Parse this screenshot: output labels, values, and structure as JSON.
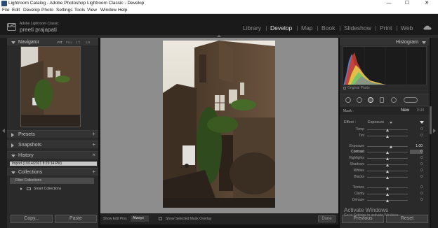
{
  "window": {
    "title": "Lightroom Catalog - Adobe Photoshop Lightroom Classic - Develop",
    "minimize": "—",
    "maximize": "☐",
    "close": "✕"
  },
  "menu": [
    "File",
    "Edit",
    "Develop",
    "Photo",
    "Settings",
    "Tools",
    "View",
    "Window",
    "Help"
  ],
  "identity": {
    "badge": "LrC",
    "product": "Adobe Lightroom Classic",
    "user": "preeti prajapati"
  },
  "modules": [
    {
      "label": "Library",
      "active": false
    },
    {
      "label": "Develop",
      "active": true
    },
    {
      "label": "Map",
      "active": false
    },
    {
      "label": "Book",
      "active": false
    },
    {
      "label": "Slideshow",
      "active": false
    },
    {
      "label": "Print",
      "active": false
    },
    {
      "label": "Web",
      "active": false
    }
  ],
  "left_panel": {
    "navigator": {
      "title": "Navigator",
      "options": [
        "FIT",
        "FILL",
        "1:1",
        "1:8"
      ]
    },
    "presets": {
      "title": "Presets",
      "add": "+"
    },
    "snapshots": {
      "title": "Snapshots",
      "add": "+"
    },
    "history": {
      "title": "History",
      "clear": "×",
      "items": [
        "Import (10/14/2021 8:29:14 PM)"
      ]
    },
    "collections": {
      "title": "Collections",
      "add": "+",
      "items": [
        "Filter Collections",
        "Smart Collections"
      ]
    },
    "copy_button": "Copy...",
    "paste_button": "Paste"
  },
  "toolbar": {
    "show_edit_pins_label": "Show Edit Pins :",
    "show_edit_pins_value": "Always",
    "show_mask_overlay": "Show Selected Mask Overlay",
    "done": "Done"
  },
  "right_panel": {
    "histogram_title": "Histogram",
    "original_photo": "Original Photo",
    "mask_label": "Mask :",
    "mask_new": "New",
    "mask_edit": "Edit",
    "effect_label": "Effect :",
    "effect_value": "Exposure",
    "sliders": [
      {
        "label": "Temp",
        "value": "0",
        "pos": 0.5
      },
      {
        "label": "Tint",
        "value": "0",
        "pos": 0.5
      },
      {
        "label": "Exposure",
        "value": "1.00",
        "pos": 0.58
      },
      {
        "label": "Contrast",
        "value": "0",
        "pos": 0.5,
        "highlight": true
      },
      {
        "label": "Highlights",
        "value": "0",
        "pos": 0.5
      },
      {
        "label": "Shadows",
        "value": "0",
        "pos": 0.5
      },
      {
        "label": "Whites",
        "value": "0",
        "pos": 0.5
      },
      {
        "label": "Blacks",
        "value": "0",
        "pos": 0.5
      },
      {
        "label": "Texture",
        "value": "0",
        "pos": 0.5
      },
      {
        "label": "Clarity",
        "value": "0",
        "pos": 0.5
      },
      {
        "label": "Dehaze",
        "value": "0",
        "pos": 0.5
      }
    ],
    "previous_button": "Previous",
    "reset_button": "Reset"
  },
  "watermark": {
    "line1": "Activate Windows",
    "line2": "Go to Settings to activate Windows."
  }
}
